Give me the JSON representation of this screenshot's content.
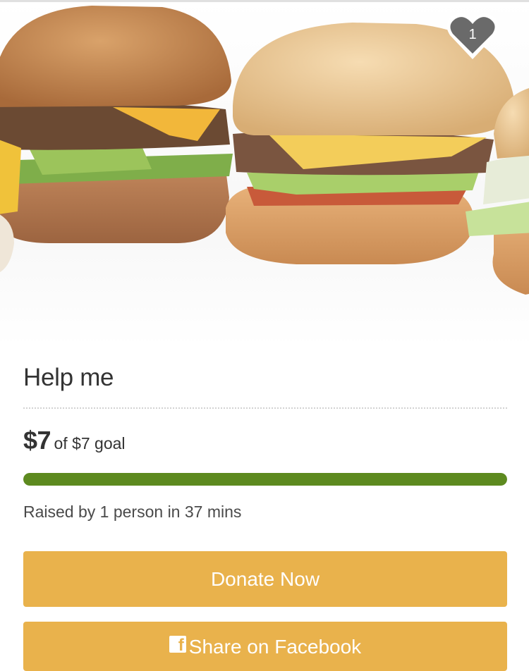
{
  "campaign": {
    "title": "Help me",
    "raised_amount": "$7",
    "goal_text": "of $7 goal",
    "progress_fraction": 1.0,
    "raised_by": "Raised by 1 person in 37 mins"
  },
  "hero": {
    "likes_count": "1",
    "icon": "heart-icon"
  },
  "actions": {
    "donate_label": "Donate Now",
    "share_label": "Share on Facebook",
    "share_icon": "facebook-icon"
  },
  "colors": {
    "button": "#e9b24c",
    "progress": "#5d8a1f",
    "badge": "#6a6a6a"
  }
}
